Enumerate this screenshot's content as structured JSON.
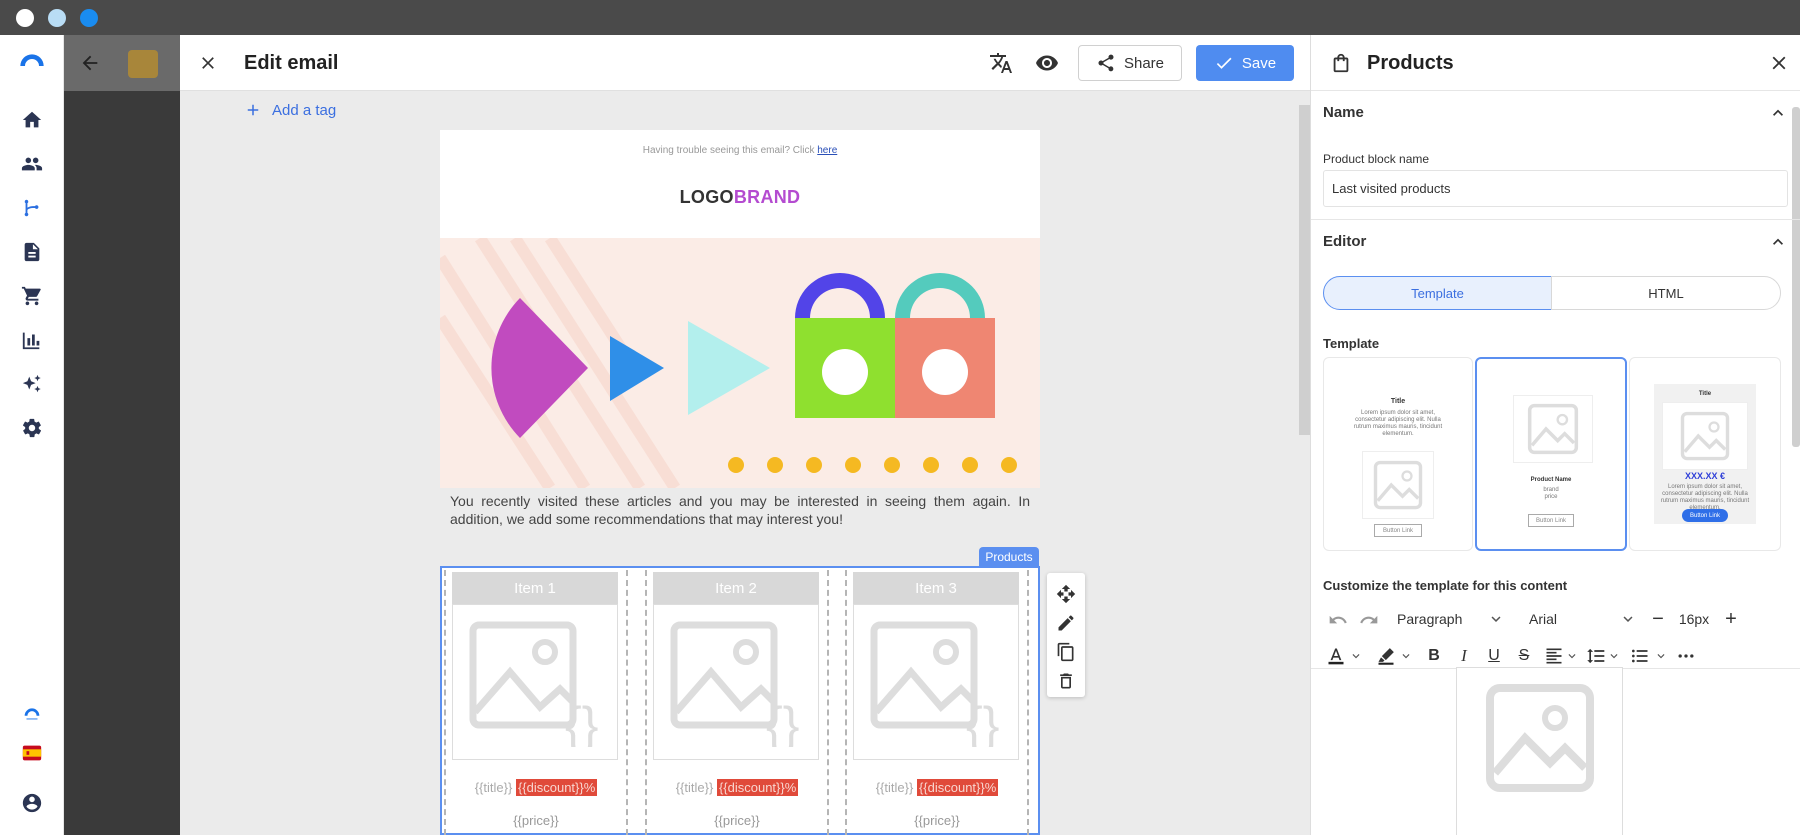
{
  "window": {
    "dot_colors": [
      "#ffffff",
      "#b9ddf5",
      "#1a8cf0"
    ]
  },
  "left_nav": {
    "items": [
      "home-icon",
      "contacts-icon",
      "automation-icon",
      "document-icon",
      "cart-icon",
      "chart-icon",
      "sparkle-icon",
      "settings-icon"
    ],
    "bottom": [
      "brand-logo-icon",
      "spain-flag-icon",
      "account-icon"
    ],
    "active": "automation-icon",
    "accent": "#2b6fe0"
  },
  "editor": {
    "title": "Edit email",
    "share_label": "Share",
    "save_label": "Save",
    "add_tag_label": "Add a tag"
  },
  "email": {
    "trouble_text": "Having trouble seeing this email? Click ",
    "trouble_link": "here",
    "logo_part1": "LOGO",
    "logo_part2": "BRAND",
    "intro": "You recently visited these articles and you may be interested in seeing them again. In addition, we add some recommendations that may interest you!",
    "products_tag": "Products",
    "items": [
      {
        "head": "Item 1",
        "title": "{{title}}",
        "discount": "{{discount}}%",
        "price": "{{price}}"
      },
      {
        "head": "Item 2",
        "title": "{{title}}",
        "discount": "{{discount}}%",
        "price": "{{price}}"
      },
      {
        "head": "Item 3",
        "title": "{{title}}",
        "discount": "{{discount}}%",
        "price": "{{price}}"
      }
    ]
  },
  "panel": {
    "title": "Products",
    "name_section": "Name",
    "product_block_label": "Product block name",
    "product_block_value": "Last visited products",
    "editor_section": "Editor",
    "tab_template": "Template",
    "tab_html": "HTML",
    "template_label": "Template",
    "templates": [
      {
        "title": "Title",
        "body": "Lorem ipsum dolor sit amet, consectetur adipiscing elit. Nulla rutrum maximus mauris, tincidunt elementum.",
        "button": "Button Link"
      },
      {
        "title": "Product Name",
        "brand": "brand",
        "price": "price",
        "button": "Button Link"
      },
      {
        "title": "Title",
        "price": "XXX.XX €",
        "body": "Lorem ipsum dolor sit amet, consectetur adipiscing elit. Nulla rutrum maximus mauris, tincidunt elementum.",
        "button": "Button Link"
      }
    ],
    "customize_label": "Customize the template for this content",
    "paragraph": "Paragraph",
    "font": "Arial",
    "font_size": "16px"
  }
}
